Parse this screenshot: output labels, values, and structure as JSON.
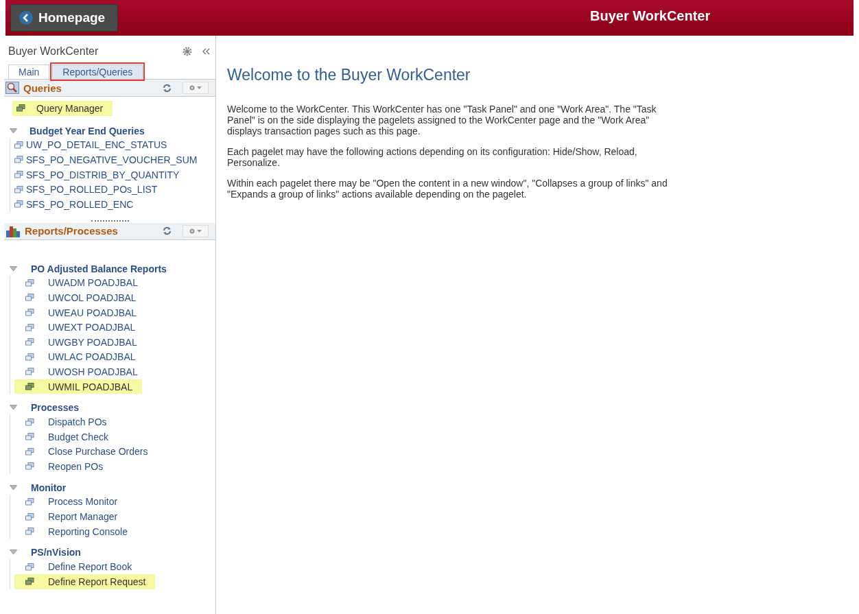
{
  "header": {
    "back_button": "Homepage",
    "title": "Buyer WorkCenter"
  },
  "task_panel": {
    "title": "Buyer WorkCenter",
    "tabs": [
      {
        "label": "Main",
        "selected": false
      },
      {
        "label": "Reports/Queries",
        "selected": true
      }
    ],
    "pagelets": [
      {
        "title": "Queries",
        "kind": "queries",
        "links": [
          {
            "label": "Query Manager",
            "highlighted": true
          }
        ],
        "groups": [
          {
            "title": "Budget Year End Queries",
            "expanded": true,
            "links": [
              {
                "label": "UW_PO_DETAIL_ENC_STATUS",
                "highlighted": false
              },
              {
                "label": "SFS_PO_NEGATIVE_VOUCHER_SUM",
                "highlighted": false
              },
              {
                "label": "SFS_PO_DISTRIB_BY_QUANTITY",
                "highlighted": false
              },
              {
                "label": "SFS_PO_ROLLED_POs_LIST",
                "highlighted": false
              },
              {
                "label": "SFS_PO_ROLLED_ENC",
                "highlighted": false
              }
            ]
          }
        ]
      },
      {
        "title": "Reports/Processes",
        "kind": "reports",
        "groups": [
          {
            "title": "PO Adjusted Balance Reports",
            "expanded": true,
            "links": [
              {
                "label": "UWADM POADJBAL",
                "highlighted": false
              },
              {
                "label": "UWCOL POADJBAL",
                "highlighted": false
              },
              {
                "label": "UWEAU POADJBAL",
                "highlighted": false
              },
              {
                "label": "UWEXT POADJBAL",
                "highlighted": false
              },
              {
                "label": "UWGBY POADJBAL",
                "highlighted": false
              },
              {
                "label": "UWLAC POADJBAL",
                "highlighted": false
              },
              {
                "label": "UWOSH POADJBAL",
                "highlighted": false
              },
              {
                "label": "UWMIL POADJBAL",
                "highlighted": true
              }
            ]
          },
          {
            "title": "Processes",
            "expanded": true,
            "links": [
              {
                "label": "Dispatch POs",
                "highlighted": false
              },
              {
                "label": "Budget Check",
                "highlighted": false
              },
              {
                "label": "Close Purchase Orders",
                "highlighted": false
              },
              {
                "label": "Reopen POs",
                "highlighted": false
              }
            ]
          },
          {
            "title": "Monitor",
            "expanded": true,
            "links": [
              {
                "label": "Process Monitor",
                "highlighted": false
              },
              {
                "label": "Report Manager",
                "highlighted": false
              },
              {
                "label": "Reporting Console",
                "highlighted": false
              }
            ]
          },
          {
            "title": "PS/nVision",
            "expanded": true,
            "links": [
              {
                "label": "Define Report Book",
                "highlighted": false
              },
              {
                "label": "Define Report Request",
                "highlighted": true
              }
            ]
          }
        ]
      }
    ]
  },
  "work_area": {
    "title": "Welcome to the Buyer WorkCenter",
    "paragraphs": [
      "Welcome to the WorkCenter. This WorkCenter has one \"Task Panel\" and one \"Work Area\". The \"Task Panel\" is on the side displaying the pagelets assigned to the WorkCenter page and the \"Work Area\" displays transaction pages such as this page.",
      "Each pagelet may have the following actions depending on its configuration: Hide/Show, Reload, Personalize.",
      "Within each pagelet there may be \"Open the content in a new window\", \"Collapses a group of links\" and \"Expands a group of links\" actions available depending on the pagelet."
    ]
  }
}
